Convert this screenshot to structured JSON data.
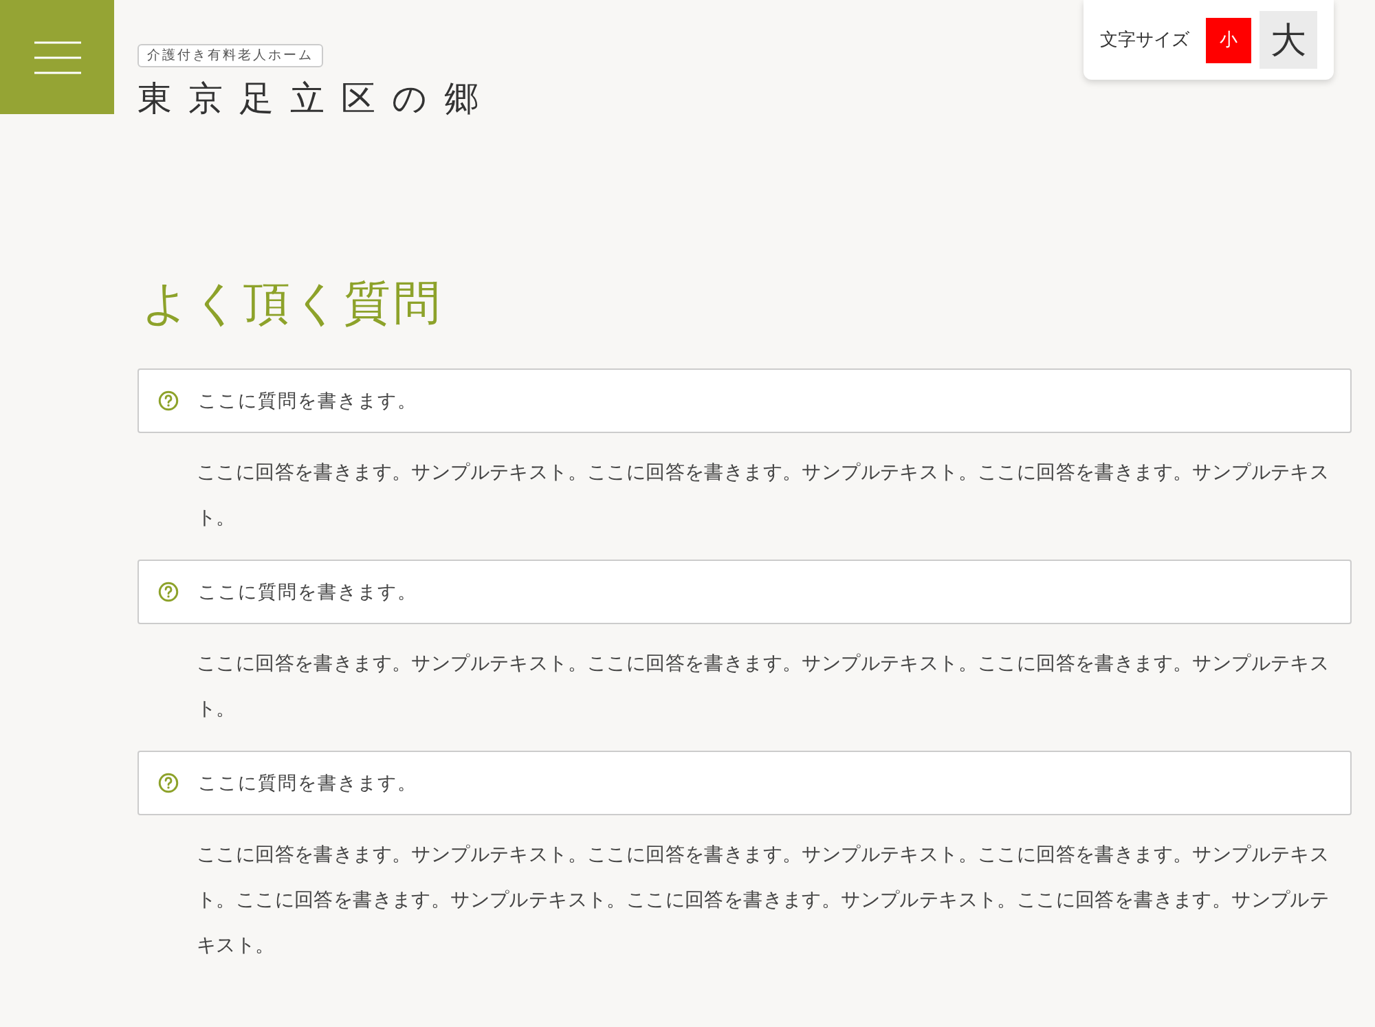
{
  "header": {
    "tagline": "介護付き有料老人ホーム",
    "logo_text": "東京足立区の郷"
  },
  "font_size": {
    "label": "文字サイズ",
    "options": [
      {
        "label": "小",
        "selected": true
      },
      {
        "label": "大",
        "selected": false
      }
    ]
  },
  "title": "よく頂く質問",
  "faq": [
    {
      "question": "ここに質問を書きます。",
      "answer": "ここに回答を書きます。サンプルテキスト。ここに回答を書きます。サンプルテキスト。ここに回答を書きます。サンプルテキスト。"
    },
    {
      "question": "ここに質問を書きます。",
      "answer": "ここに回答を書きます。サンプルテキスト。ここに回答を書きます。サンプルテキスト。ここに回答を書きます。サンプルテキスト。"
    },
    {
      "question": "ここに質問を書きます。",
      "answer": "ここに回答を書きます。サンプルテキスト。ここに回答を書きます。サンプルテキスト。ここに回答を書きます。サンプルテキスト。ここに回答を書きます。サンプルテキスト。ここに回答を書きます。サンプルテキスト。ここに回答を書きます。サンプルテキスト。"
    }
  ]
}
